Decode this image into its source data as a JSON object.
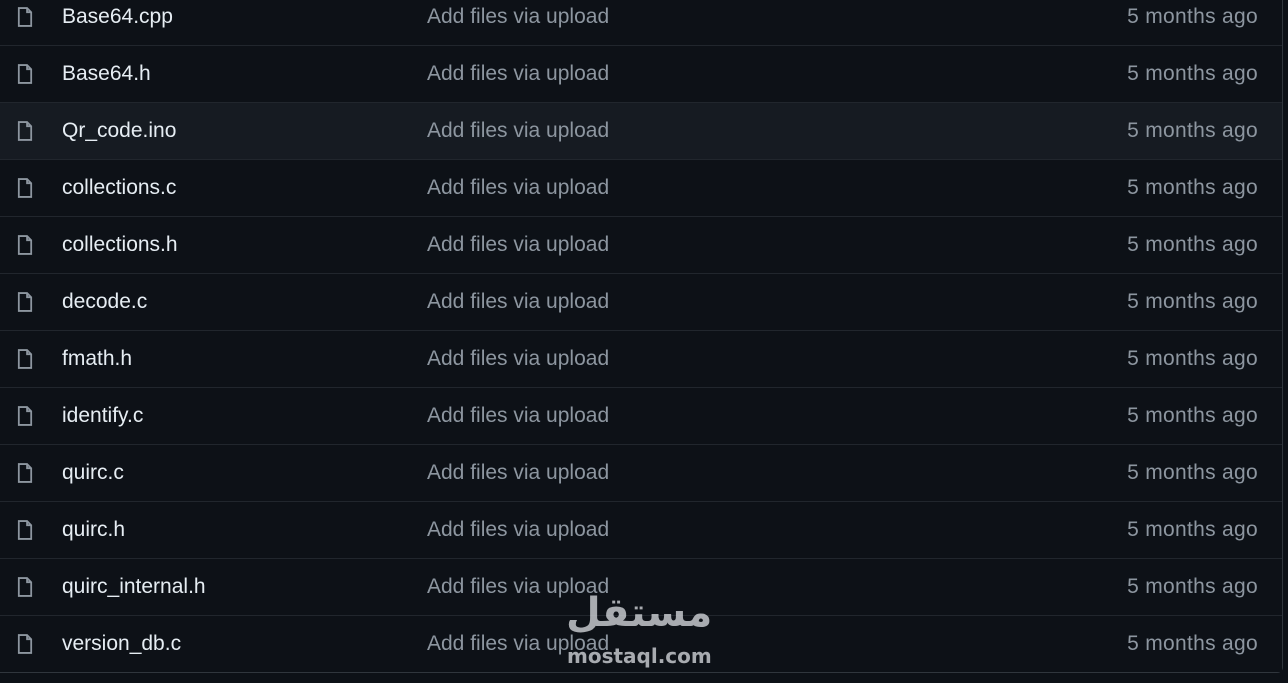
{
  "files": [
    {
      "name": "Base64.cpp",
      "message": "Add files via upload",
      "age": "5 months ago",
      "icon": "file-icon"
    },
    {
      "name": "Base64.h",
      "message": "Add files via upload",
      "age": "5 months ago",
      "icon": "file-icon"
    },
    {
      "name": "Qr_code.ino",
      "message": "Add files via upload",
      "age": "5 months ago",
      "icon": "file-icon"
    },
    {
      "name": "collections.c",
      "message": "Add files via upload",
      "age": "5 months ago",
      "icon": "file-icon"
    },
    {
      "name": "collections.h",
      "message": "Add files via upload",
      "age": "5 months ago",
      "icon": "file-icon"
    },
    {
      "name": "decode.c",
      "message": "Add files via upload",
      "age": "5 months ago",
      "icon": "file-icon"
    },
    {
      "name": "fmath.h",
      "message": "Add files via upload",
      "age": "5 months ago",
      "icon": "file-icon"
    },
    {
      "name": "identify.c",
      "message": "Add files via upload",
      "age": "5 months ago",
      "icon": "file-icon"
    },
    {
      "name": "quirc.c",
      "message": "Add files via upload",
      "age": "5 months ago",
      "icon": "file-icon"
    },
    {
      "name": "quirc.h",
      "message": "Add files via upload",
      "age": "5 months ago",
      "icon": "file-icon"
    },
    {
      "name": "quirc_internal.h",
      "message": "Add files via upload",
      "age": "5 months ago",
      "icon": "file-icon"
    },
    {
      "name": "version_db.c",
      "message": "Add files via upload",
      "age": "5 months ago",
      "icon": "file-icon"
    }
  ],
  "watermark": {
    "arabic": "مستقل",
    "latin": "mostaql.com"
  },
  "colors": {
    "background": "#0d1117",
    "row_hover": "#161b22",
    "border": "#21262d",
    "text_primary": "#e6edf3",
    "text_muted": "#8d96a0"
  }
}
